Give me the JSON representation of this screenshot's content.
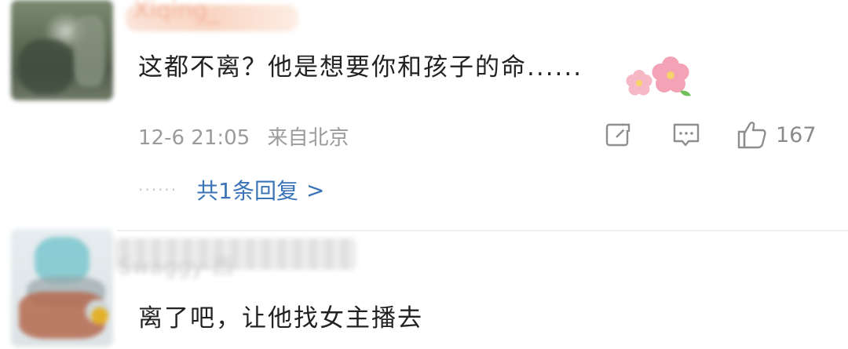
{
  "comments": [
    {
      "username": "Xiqing_",
      "text": "这都不离？他是想要你和孩子的命......",
      "emoji": "cherry-blossom",
      "timestamp": "12-6 21:05",
      "location": "来自北京",
      "likes": "167",
      "replies_label": "共1条回复",
      "replies_prefix": "······",
      "replies_chevron": ">"
    },
    {
      "username": "Swaggy-西",
      "text": "离了吧，让他找女主播去"
    }
  ],
  "icons": {
    "share": "share-icon",
    "comment": "comment-icon",
    "like": "thumbs-up-icon"
  },
  "colors": {
    "link": "#3a73b8",
    "meta": "#9b9b9b",
    "text": "#222222",
    "blossom": "#f4a3b6"
  }
}
